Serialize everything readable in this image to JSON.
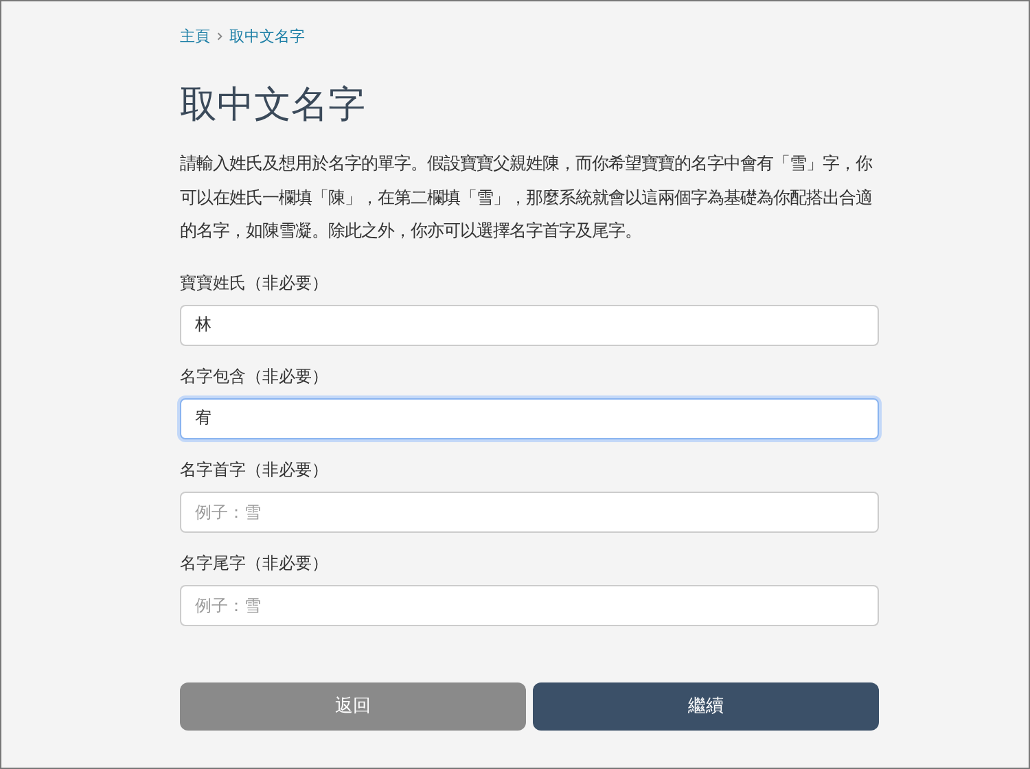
{
  "breadcrumb": [
    {
      "label": "主頁"
    },
    {
      "label": "取中文名字"
    }
  ],
  "title": "取中文名字",
  "description": "請輸入姓氏及想用於名字的單字。假設寶寶父親姓陳，而你希望寶寶的名字中會有「雪」字，你可以在姓氏一欄填「陳」，在第二欄填「雪」，那麼系統就會以這兩個字為基礎為你配搭出合適的名字，如陳雪凝。除此之外，你亦可以選擇名字首字及尾字。",
  "fields": [
    {
      "label": "寶寶姓氏（非必要）",
      "value": "林",
      "focused": false
    },
    {
      "label": "名字包含（非必要）",
      "value": "宥",
      "focused": true
    },
    {
      "label": "名字首字（非必要）",
      "placeholder": "例子：雪",
      "focused": false
    },
    {
      "label": "名字尾字（非必要）",
      "placeholder": "例子：雪",
      "focused": false
    }
  ],
  "buttons": [
    {
      "label": "返回",
      "kind": "secondary"
    },
    {
      "label": "繼續",
      "kind": "primary"
    }
  ]
}
